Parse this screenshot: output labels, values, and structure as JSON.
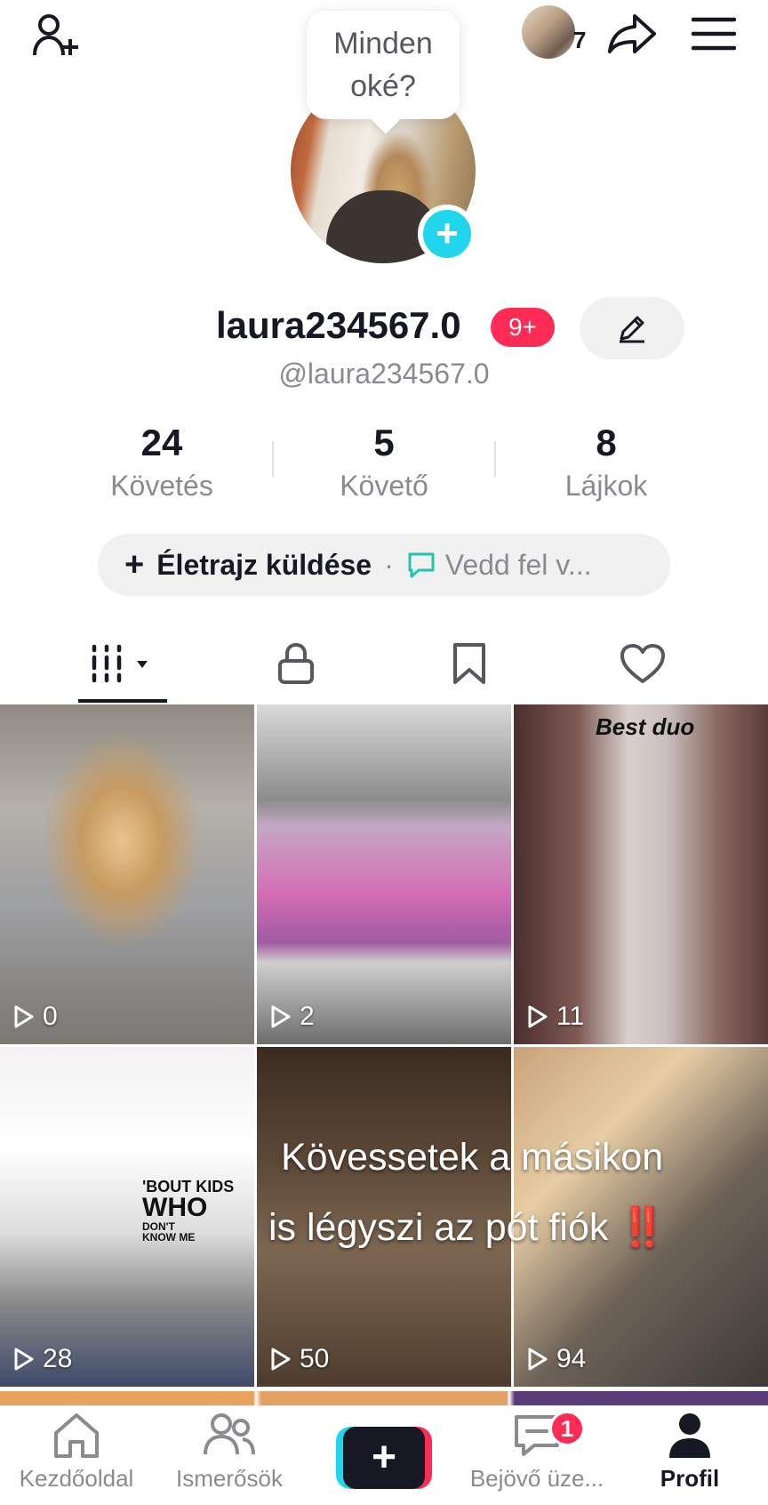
{
  "header": {
    "story_count": "7",
    "bubble_text": "Minden oké?"
  },
  "profile": {
    "display_name": "laura234567.0",
    "badge": "9+",
    "handle": "@laura234567.0"
  },
  "stats": [
    {
      "value": "24",
      "label": "Követés"
    },
    {
      "value": "5",
      "label": "Követő"
    },
    {
      "value": "8",
      "label": "Lájkok"
    }
  ],
  "bio": {
    "add_label": "Életrajz küldése",
    "plus": "+",
    "separator": "·",
    "voice_label": "Vedd fel v..."
  },
  "tabs": [
    "videos",
    "private",
    "saved",
    "liked"
  ],
  "videos": [
    {
      "views": "0"
    },
    {
      "views": "2"
    },
    {
      "views": "11",
      "caption": "Best duo"
    },
    {
      "views": "28",
      "text_lines": [
        "'BOUT KIDS",
        "WHO",
        "DON'T",
        "KNOW ME"
      ]
    },
    {
      "views": "50"
    },
    {
      "views": "94"
    }
  ],
  "overlay": {
    "line1": "Kövessetek a másikon",
    "line2": "is légyszi az pót fiók",
    "mark": "‼️"
  },
  "bottom_nav": {
    "home": "Kezdőoldal",
    "friends": "Ismerősök",
    "create": "+",
    "inbox": "Bejövő üze...",
    "inbox_badge": "1",
    "profile": "Profil"
  },
  "colors": {
    "accent_red": "#fe2c55",
    "accent_cyan": "#20d5ec",
    "text_primary": "#161823",
    "text_secondary": "#8a8b91"
  }
}
